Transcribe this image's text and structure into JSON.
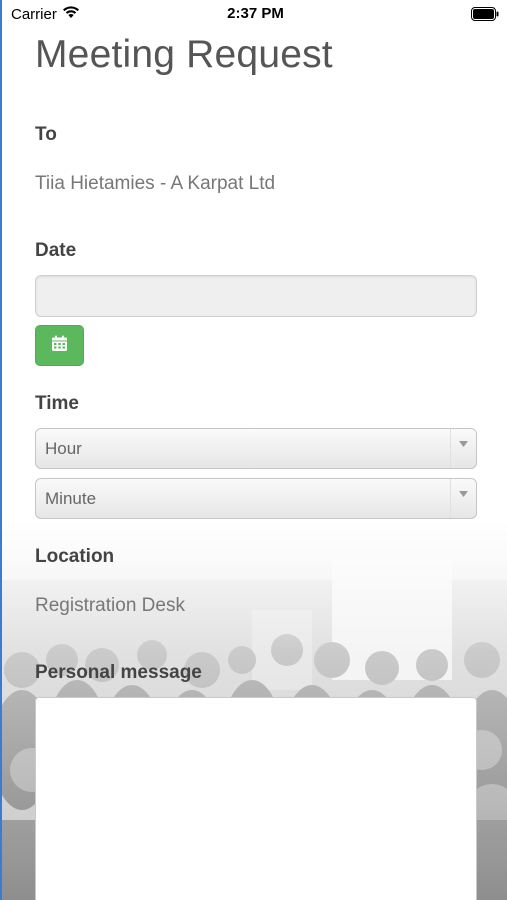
{
  "status_bar": {
    "carrier": "Carrier",
    "time": "2:37 PM"
  },
  "form": {
    "title": "Meeting Request",
    "to_label": "To",
    "to_value": "Tiia Hietamies - A Karpat Ltd",
    "date_label": "Date",
    "date_value": "",
    "time_label": "Time",
    "hour_select": "Hour",
    "minute_select": "Minute",
    "location_label": "Location",
    "location_value": "Registration Desk",
    "message_label": "Personal message",
    "message_value": ""
  },
  "colors": {
    "accent_green": "#5cb85c",
    "left_edge": "#3a7bd5"
  },
  "icons": [
    "wifi-icon",
    "battery-icon",
    "calendar-icon",
    "chevron-down-icon"
  ]
}
